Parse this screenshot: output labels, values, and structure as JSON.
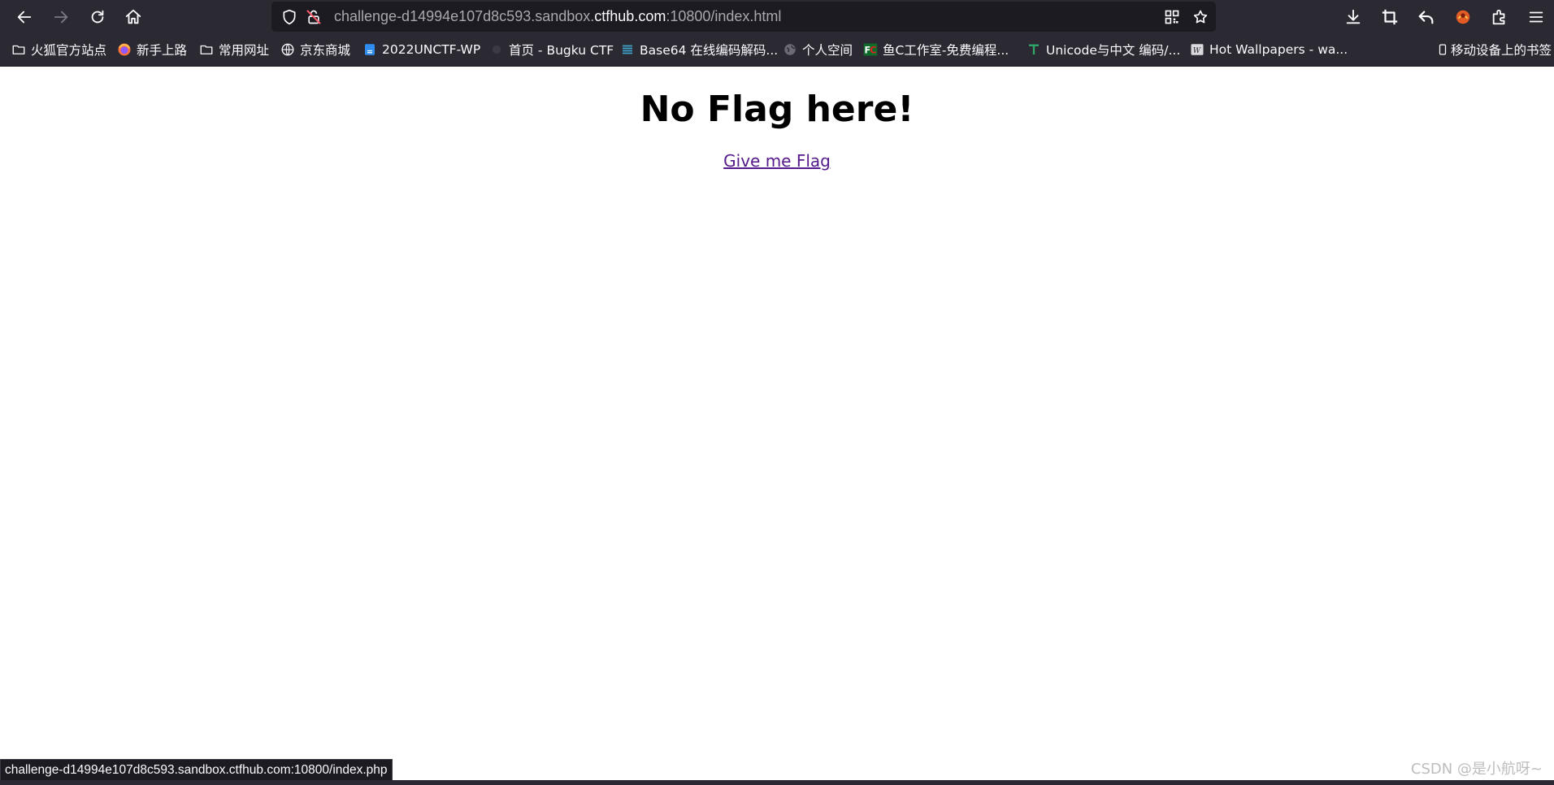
{
  "browser": {
    "url_prefix": "challenge-d14994e107d8c593.sandbox.",
    "url_host": "ctfhub.com",
    "url_suffix": ":10800/index.html"
  },
  "bookmarks": {
    "items": [
      {
        "label": "火狐官方站点",
        "icon": "folder-icon"
      },
      {
        "label": "新手上路",
        "icon": "firefox-icon"
      },
      {
        "label": "常用网址",
        "icon": "folder-icon"
      },
      {
        "label": "京东商城",
        "icon": "globe-icon"
      },
      {
        "label": "2022UNCTF-WP",
        "icon": "document-icon"
      },
      {
        "label": "首页 - Bugku CTF",
        "icon": "bugku-icon"
      },
      {
        "label": "Base64 在线编码解码...",
        "icon": "base64-icon"
      },
      {
        "label": "个人空间",
        "icon": "globe-icon"
      },
      {
        "label": "鱼C工作室-免费编程...",
        "icon": "fc-icon"
      },
      {
        "label": "Unicode与中文 编码/...",
        "icon": "t-icon"
      },
      {
        "label": "Hot Wallpapers - wa...",
        "icon": "wallpaper-icon"
      }
    ],
    "mobile_label": "移动设备上的书签"
  },
  "page": {
    "heading": "No Flag here!",
    "link_label": "Give me Flag"
  },
  "status": {
    "hover_url": "challenge-d14994e107d8c593.sandbox.ctfhub.com:10800/index.php"
  },
  "watermark": "CSDN @是小航呀~",
  "colors": {
    "toolbar_bg": "#2b2a33",
    "urlbar_bg": "#1c1b22",
    "link_visited": "#551a8b",
    "page_bg": "#ffffff"
  }
}
